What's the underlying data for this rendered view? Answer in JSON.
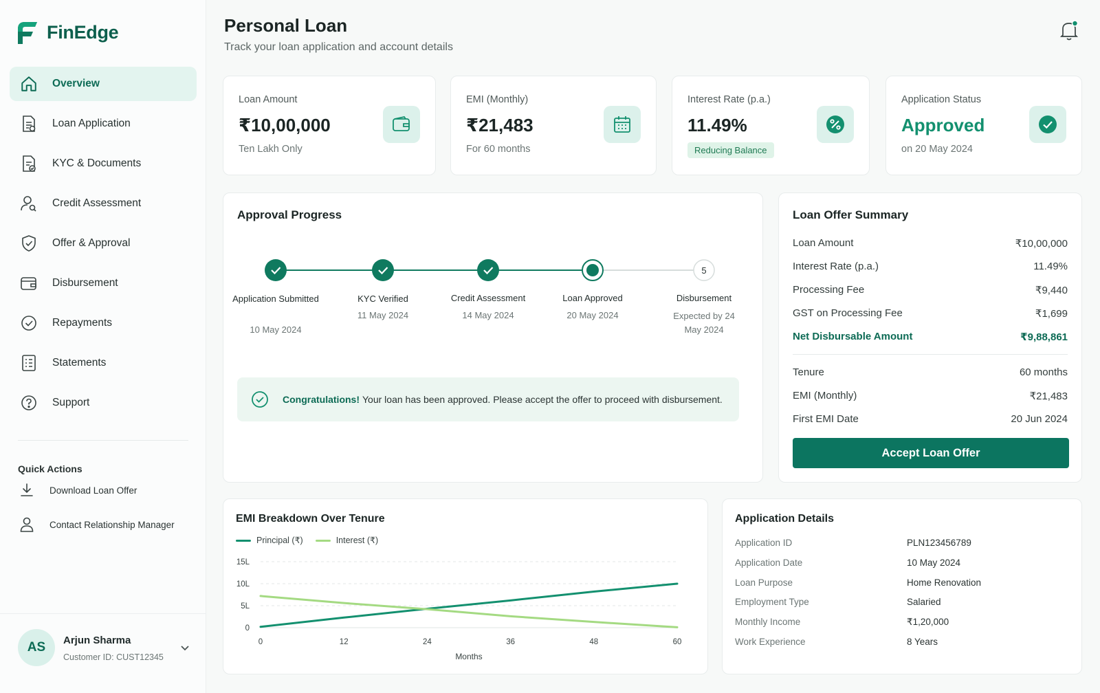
{
  "app": {
    "name": "FinEdge"
  },
  "colors": {
    "primary": "#0c7560",
    "accent": "#13906f",
    "soft": "#dcf1eb",
    "principal": "#13906f",
    "interest": "#a4da82"
  },
  "sidebar": {
    "items": [
      {
        "label": "Overview",
        "icon": "home-icon",
        "active": true
      },
      {
        "label": "Loan Application",
        "icon": "document-icon"
      },
      {
        "label": "KYC & Documents",
        "icon": "document-check-icon"
      },
      {
        "label": "Credit Assessment",
        "icon": "user-search-icon"
      },
      {
        "label": "Offer & Approval",
        "icon": "shield-check-icon"
      },
      {
        "label": "Disbursement",
        "icon": "wallet-icon"
      },
      {
        "label": "Repayments",
        "icon": "check-circle-icon"
      },
      {
        "label": "Statements",
        "icon": "statement-icon"
      },
      {
        "label": "Support",
        "icon": "help-icon"
      }
    ],
    "quick_actions_title": "Quick Actions",
    "quick_actions": [
      {
        "label": "Download Loan Offer",
        "icon": "download-icon"
      },
      {
        "label": "Contact Relationship Manager",
        "icon": "user-icon"
      }
    ],
    "user": {
      "initials": "AS",
      "name": "Arjun Sharma",
      "customer_id": "Customer ID: CUST12345"
    }
  },
  "header": {
    "title": "Personal Loan",
    "subtitle": "Track your loan application and account details"
  },
  "stats": [
    {
      "label": "Loan Amount",
      "value": "₹10,00,000",
      "sub": "Ten Lakh Only",
      "icon": "wallet-icon"
    },
    {
      "label": "EMI (Monthly)",
      "value": "₹21,483",
      "sub": "For 60 months",
      "icon": "calendar-icon"
    },
    {
      "label": "Interest Rate (p.a.)",
      "value": "11.49%",
      "pill": "Reducing Balance",
      "icon": "percent-icon"
    },
    {
      "label": "Application Status",
      "value": "Approved",
      "sub": "on 20 May 2024",
      "icon": "check-icon"
    }
  ],
  "progress": {
    "title": "Approval Progress",
    "steps": [
      {
        "label": "Application Submitted",
        "date": "10 May 2024",
        "state": "done"
      },
      {
        "label": "KYC Verified",
        "date": "11 May 2024",
        "state": "done"
      },
      {
        "label": "Credit Assessment",
        "date": "14 May 2024",
        "state": "done"
      },
      {
        "label": "Loan Approved",
        "date": "20 May 2024",
        "state": "current"
      },
      {
        "label": "Disbursement",
        "date": "Expected by 24 May 2024",
        "state": "pending",
        "number": "5"
      }
    ],
    "banner_strong": "Congratulations!",
    "banner_text": "Your loan has been approved. Please accept the offer to proceed with disbursement."
  },
  "summary": {
    "title": "Loan Offer Summary",
    "rows": [
      {
        "k": "Loan Amount",
        "v": "₹10,00,000"
      },
      {
        "k": "Interest Rate (p.a.)",
        "v": "11.49%"
      },
      {
        "k": "Processing Fee",
        "v": "₹9,440"
      },
      {
        "k": "GST on Processing Fee",
        "v": "₹1,699"
      },
      {
        "k": "Net Disbursable Amount",
        "v": "₹9,88,861"
      },
      {
        "k": "Tenure",
        "v": "60 months"
      },
      {
        "k": "EMI (Monthly)",
        "v": "₹21,483"
      },
      {
        "k": "First EMI Date",
        "v": "20 Jun 2024"
      }
    ],
    "button": "Accept Loan Offer"
  },
  "chart_data": {
    "type": "line",
    "title": "EMI Breakdown Over Tenure",
    "xlabel": "Months",
    "ylabel": "",
    "x": [
      0,
      12,
      24,
      36,
      48,
      60
    ],
    "xlim": [
      0,
      60
    ],
    "ylim": [
      0,
      15
    ],
    "yticks": [
      "0",
      "5L",
      "10L",
      "15L"
    ],
    "ytick_values": [
      0,
      5,
      10,
      15
    ],
    "grid": true,
    "legend_position": "top-left",
    "series": [
      {
        "name": "Principal (₹)",
        "values": [
          0.2,
          2.3,
          4.3,
          6.2,
          8.2,
          10
        ],
        "color": "#13906f"
      },
      {
        "name": "Interest (₹)",
        "values": [
          7.2,
          5.6,
          4.2,
          2.6,
          1.3,
          0.1
        ],
        "color": "#a4da82"
      }
    ]
  },
  "details": {
    "title": "Application Details",
    "rows": [
      {
        "k": "Application ID",
        "v": "PLN123456789"
      },
      {
        "k": "Application Date",
        "v": "10 May 2024"
      },
      {
        "k": "Loan Purpose",
        "v": "Home Renovation"
      },
      {
        "k": "Employment Type",
        "v": "Salaried"
      },
      {
        "k": "Monthly Income",
        "v": "₹1,20,000"
      },
      {
        "k": "Work Experience",
        "v": "8 Years"
      }
    ]
  }
}
